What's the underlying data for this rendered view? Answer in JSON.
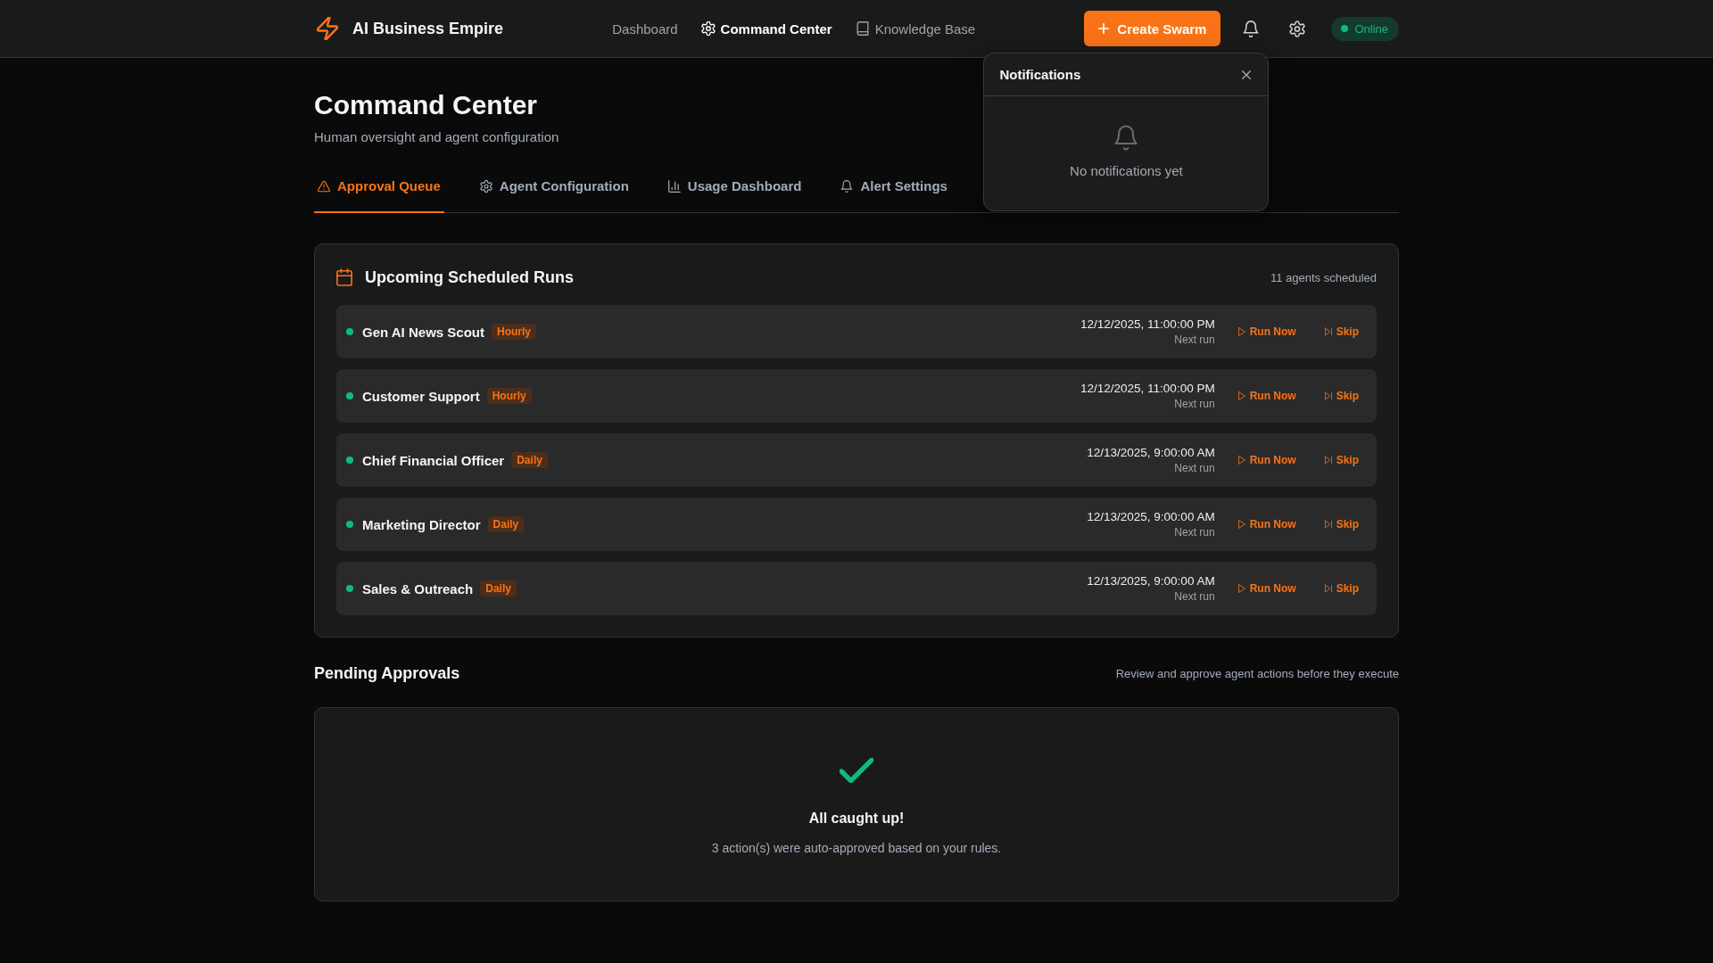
{
  "header": {
    "brand": "AI Business Empire",
    "nav": [
      {
        "label": "Dashboard",
        "selected": false
      },
      {
        "label": "Command Center",
        "selected": true
      },
      {
        "label": "Knowledge Base",
        "selected": false
      }
    ],
    "create_button": "Create Swarm",
    "status": {
      "label": "Online"
    }
  },
  "notifications": {
    "title": "Notifications",
    "empty_text": "No notifications yet"
  },
  "page": {
    "title": "Command Center",
    "subtitle": "Human oversight and agent configuration"
  },
  "tabs": [
    {
      "label": "Approval Queue",
      "selected": true
    },
    {
      "label": "Agent Configuration",
      "selected": false
    },
    {
      "label": "Usage Dashboard",
      "selected": false
    },
    {
      "label": "Alert Settings",
      "selected": false
    }
  ],
  "scheduled": {
    "title": "Upcoming Scheduled Runs",
    "count": "11 agents scheduled",
    "runs": [
      {
        "name": "Gen AI News Scout",
        "active": true,
        "frequency": "Hourly",
        "next_run": "12/12/2025, 11:00:00 PM",
        "next_run_label": "Next run",
        "run_label": "Run Now",
        "skip_label": "Skip"
      },
      {
        "name": "Customer Support",
        "active": true,
        "frequency": "Hourly",
        "next_run": "12/12/2025, 11:00:00 PM",
        "next_run_label": "Next run",
        "run_label": "Run Now",
        "skip_label": "Skip"
      },
      {
        "name": "Chief Financial Officer",
        "active": true,
        "frequency": "Daily",
        "next_run": "12/13/2025, 9:00:00 AM",
        "next_run_label": "Next run",
        "run_label": "Run Now",
        "skip_label": "Skip"
      },
      {
        "name": "Marketing Director",
        "active": true,
        "frequency": "Daily",
        "next_run": "12/13/2025, 9:00:00 AM",
        "next_run_label": "Next run",
        "run_label": "Run Now",
        "skip_label": "Skip"
      },
      {
        "name": "Sales & Outreach",
        "active": true,
        "frequency": "Daily",
        "next_run": "12/13/2025, 9:00:00 AM",
        "next_run_label": "Next run",
        "run_label": "Run Now",
        "skip_label": "Skip"
      }
    ]
  },
  "pending": {
    "title": "Pending Approvals",
    "description": "Review and approve agent actions before they execute",
    "empty_title": "All caught up!",
    "empty_message": "3 action(s) were auto-approved based on your rules."
  }
}
